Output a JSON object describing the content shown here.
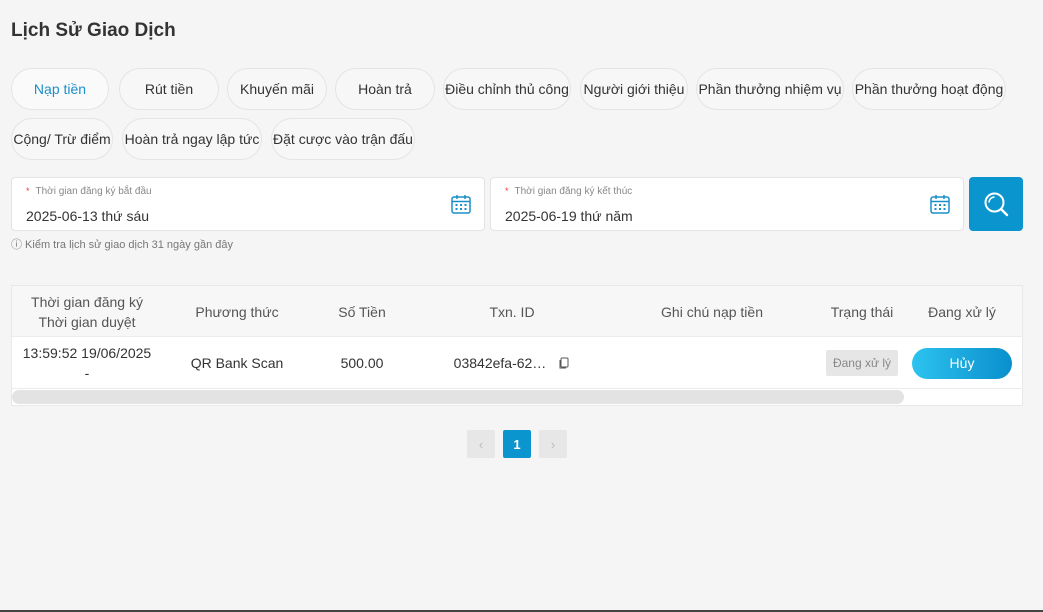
{
  "page": {
    "title": "Lịch Sử Giao Dịch"
  },
  "tabs": [
    {
      "label": "Nạp tiền",
      "active": true
    },
    {
      "label": "Rút tiền"
    },
    {
      "label": "Khuyến mãi"
    },
    {
      "label": "Hoàn trả"
    },
    {
      "label": "Điều chỉnh thủ công"
    },
    {
      "label": "Người giới thiệu"
    },
    {
      "label": "Phần thưởng nhiệm vụ"
    },
    {
      "label": "Phần thưởng hoạt động"
    },
    {
      "label": "Cộng/ Trừ điểm"
    },
    {
      "label": "Hoàn trả ngay lập tức"
    },
    {
      "label": "Đặt cược vào trận đấu"
    }
  ],
  "filters": {
    "start": {
      "label": "Thời gian đăng ký bắt đầu",
      "value": "2025-06-13 thứ sáu",
      "required_mark": "*"
    },
    "end": {
      "label": "Thời gian đăng ký kết thúc",
      "value": "2025-06-19 thứ năm",
      "required_mark": "*"
    },
    "hint": "ⓘ Kiểm tra lịch sử giao dịch 31 ngày gần đây"
  },
  "table": {
    "headers": {
      "time_line1": "Thời gian đăng ký",
      "time_line2": "Thời gian duyệt",
      "method": "Phương thức",
      "amount": "Số Tiền",
      "txn": "Txn. ID",
      "note": "Ghi chú nạp tiền",
      "status": "Trạng thái",
      "processing": "Đang xử lý"
    },
    "rows": [
      {
        "time_registered": "13:59:52 19/06/2025",
        "time_approved": "-",
        "method": "QR Bank Scan",
        "amount": "500.00",
        "txn_id": "03842efa-62…",
        "note": "",
        "status": "Đang xử lý",
        "action": "Hủy"
      }
    ]
  },
  "pagination": {
    "prev": "‹",
    "current": "1",
    "next": "›"
  },
  "colors": {
    "accent": "#0b95cf",
    "active_tab_text": "#1a8fc9"
  }
}
